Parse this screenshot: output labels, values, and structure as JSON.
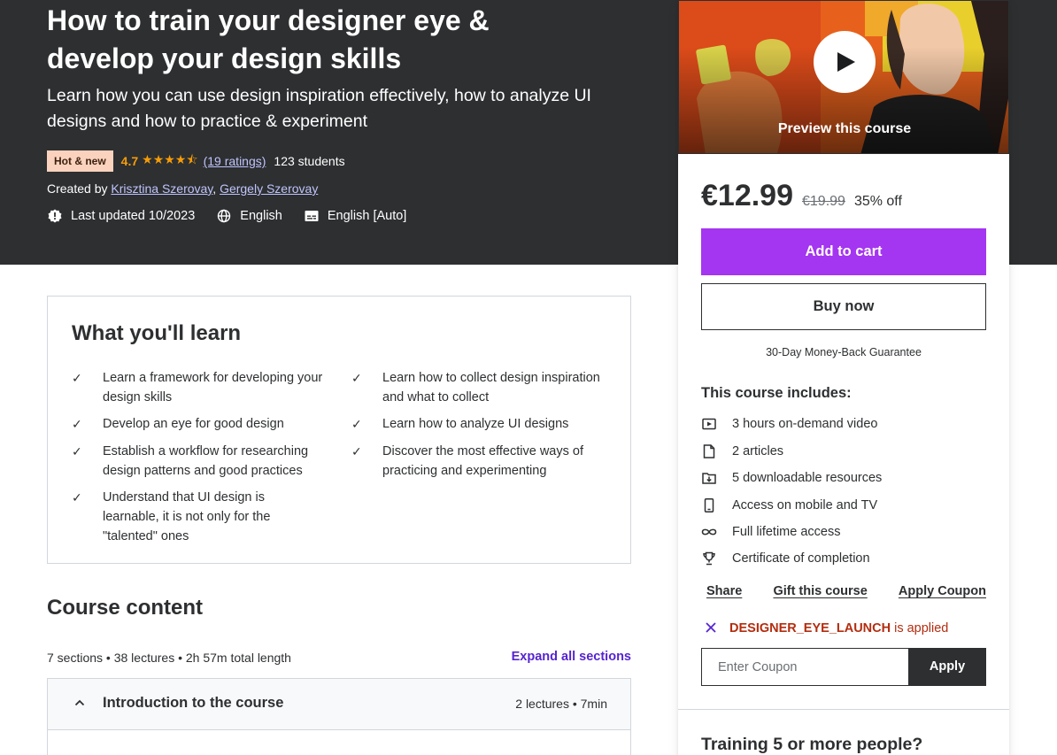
{
  "hero": {
    "title": "How to train your designer eye & develop your design skills",
    "subtitle": "Learn how you can use design inspiration effectively, how to analyze UI designs and how to practice & experiment",
    "badge": "Hot & new",
    "rating": "4.7",
    "stars": "★★★★⯪",
    "ratings_link": "(19 ratings)",
    "students": "123 students",
    "created_by_label": "Created by",
    "instructors": [
      "Krisztina Szerovay",
      "Gergely Szerovay"
    ],
    "last_updated": "Last updated 10/2023",
    "language": "English",
    "captions": "English [Auto]"
  },
  "learn": {
    "title": "What you'll learn",
    "items": [
      "Learn a framework for developing your design skills",
      "Learn how to collect design inspiration and what to collect",
      "Develop an eye for good design",
      "Learn how to analyze UI designs",
      "Establish a workflow for researching design patterns and good practices",
      "Discover the most effective ways of practicing and experimenting",
      "Understand that UI design is learnable, it is not only for the \"talented\" ones"
    ],
    "check_icon": "check-icon"
  },
  "content": {
    "title": "Course content",
    "meta": "7 sections • 38 lectures • 2h 57m total length",
    "expand_all": "Expand all sections",
    "sections": [
      {
        "title": "Introduction to the course",
        "info": "2 lectures • 7min"
      }
    ]
  },
  "sidebar": {
    "preview_label": "Preview this course",
    "price": "€12.99",
    "old_price": "€19.99",
    "discount": "35% off",
    "add_to_cart": "Add to cart",
    "buy_now": "Buy now",
    "guarantee": "30-Day Money-Back Guarantee",
    "includes_title": "This course includes:",
    "includes": [
      {
        "icon": "video-icon",
        "label": "3 hours on-demand video"
      },
      {
        "icon": "article-icon",
        "label": "2 articles"
      },
      {
        "icon": "download-icon",
        "label": "5 downloadable resources"
      },
      {
        "icon": "mobile-icon",
        "label": "Access on mobile and TV"
      },
      {
        "icon": "infinity-icon",
        "label": "Full lifetime access"
      },
      {
        "icon": "trophy-icon",
        "label": "Certificate of completion"
      }
    ],
    "share": "Share",
    "gift": "Gift this course",
    "apply_coupon": "Apply Coupon",
    "coupon_code": "DESIGNER_EYE_LAUNCH",
    "coupon_applied_suffix": "is applied",
    "coupon_placeholder": "Enter Coupon",
    "apply": "Apply",
    "training_title": "Training 5 or more people?"
  },
  "colors": {
    "hero_bg": "#2d2f31",
    "accent_purple": "#a435f0",
    "link_purple": "#5624d0",
    "star_orange": "#f69c08",
    "badge_bg": "#fbd2bd",
    "coupon_red": "#b32d0f"
  }
}
